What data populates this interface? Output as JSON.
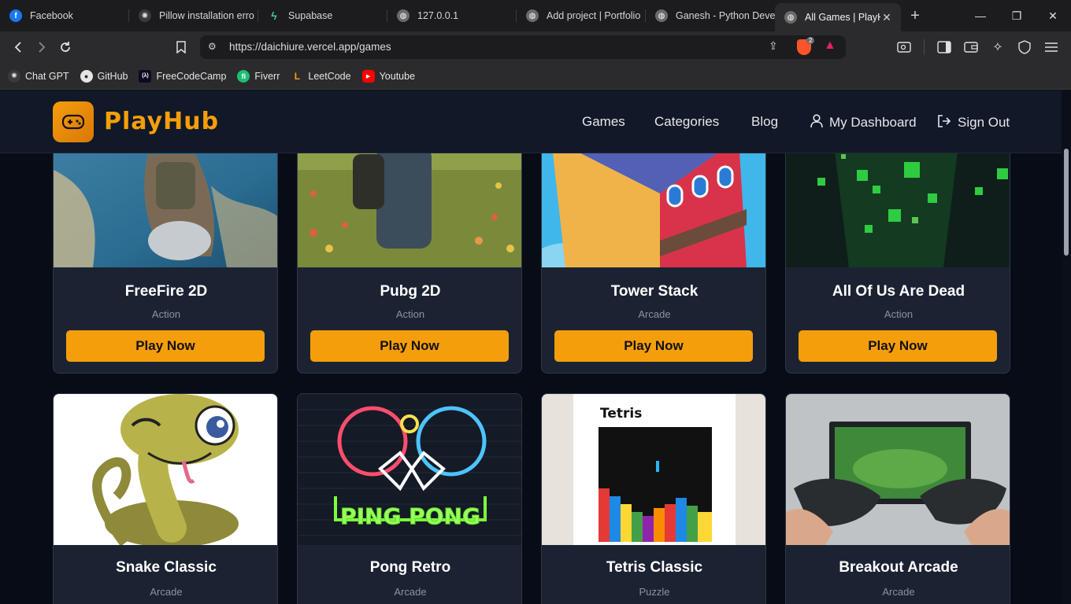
{
  "browser": {
    "tabs": [
      {
        "title": "Facebook",
        "icon": "facebook-icon",
        "color": "#1877f2",
        "glyph": "f"
      },
      {
        "title": "Pillow installation erro",
        "icon": "chatgpt-icon",
        "color": "#d0d0d0",
        "glyph": "✺"
      },
      {
        "title": "Supabase",
        "icon": "supabase-icon",
        "color": "#3ecf8e",
        "glyph": "ϟ"
      },
      {
        "title": "127.0.0.1",
        "icon": "globe-icon",
        "color": "#9a9a9a",
        "glyph": "◍"
      },
      {
        "title": "Add project | Portfolio",
        "icon": "globe-icon",
        "color": "#9a9a9a",
        "glyph": "◍"
      },
      {
        "title": "Ganesh - Python Deve",
        "icon": "globe-icon",
        "color": "#9a9a9a",
        "glyph": "◍"
      },
      {
        "title": "All Games | PlayH",
        "icon": "globe-icon",
        "color": "#9a9a9a",
        "glyph": "◍",
        "active": true
      }
    ],
    "url": "https://daichiure.vercel.app/games",
    "brave_badge": "2",
    "bookmarks": [
      {
        "label": "Chat GPT",
        "icon": "chatgpt-icon",
        "color": "#d6d6d6",
        "glyph": "✺"
      },
      {
        "label": "GitHub",
        "icon": "github-icon",
        "color": "#e5e5e5",
        "glyph": "●"
      },
      {
        "label": "FreeCodeCamp",
        "icon": "freecodecamp-icon",
        "color": "#0a0a23",
        "glyph": "(λ)"
      },
      {
        "label": "Fiverr",
        "icon": "fiverr-icon",
        "color": "#1dbf73",
        "glyph": "fi"
      },
      {
        "label": "LeetCode",
        "icon": "leetcode-icon",
        "color": "#f89f1b",
        "glyph": "L"
      },
      {
        "label": "Youtube",
        "icon": "youtube-icon",
        "color": "#ff0000",
        "glyph": "▶"
      }
    ]
  },
  "site": {
    "brand": "PlayHub",
    "nav": {
      "games": "Games",
      "categories": "Categories",
      "blog": "Blog",
      "dashboard": "My Dashboard",
      "signout": "Sign Out"
    }
  },
  "games": [
    {
      "title": "FreeFire 2D",
      "category": "Action",
      "button": "Play Now"
    },
    {
      "title": "Pubg 2D",
      "category": "Action",
      "button": "Play Now"
    },
    {
      "title": "Tower Stack",
      "category": "Arcade",
      "button": "Play Now"
    },
    {
      "title": "All Of Us Are Dead",
      "category": "Action",
      "button": "Play Now"
    },
    {
      "title": "Snake Classic",
      "category": "Arcade"
    },
    {
      "title": "Pong Retro",
      "category": "Arcade",
      "image_text": "PING PONG"
    },
    {
      "title": "Tetris Classic",
      "category": "Puzzle",
      "image_text": "Tetris"
    },
    {
      "title": "Breakout Arcade",
      "category": "Arcade"
    }
  ],
  "colors": {
    "accent": "#f59e0b",
    "card_bg": "#1b2333",
    "page_bg": "#080c16",
    "nav_bg": "#111827"
  }
}
